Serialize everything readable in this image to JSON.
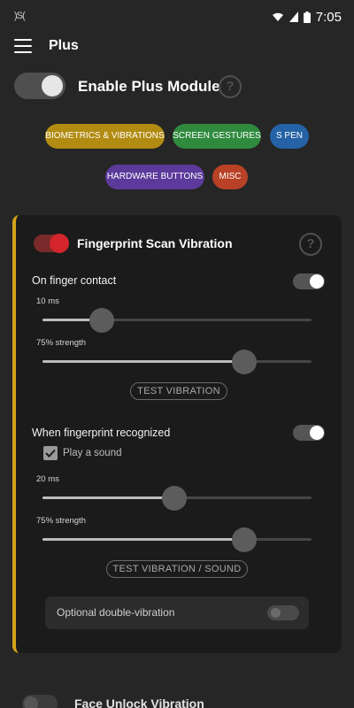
{
  "status_bar": {
    "left_glyph": ")S(",
    "time": "7:05"
  },
  "app_bar": {
    "title": "Plus"
  },
  "module": {
    "label": "Enable Plus Module",
    "enabled": true,
    "help": "?"
  },
  "chips": [
    {
      "label": "BIOMETRICS & VIBRATIONS",
      "color": "#b28b12"
    },
    {
      "label": "SCREEN GESTURES",
      "color": "#2f8a3e"
    },
    {
      "label": "S PEN",
      "color": "#2562a6"
    },
    {
      "label": "HARDWARE BUTTONS",
      "color": "#5c3a9b"
    },
    {
      "label": "MISC",
      "color": "#b84126"
    }
  ],
  "card": {
    "title": "Fingerprint Scan Vibration",
    "enabled": true,
    "accent": "#d4a21a",
    "help": "?",
    "contact": {
      "label": "On finger contact",
      "enabled": true,
      "duration_label": "10 ms",
      "duration_value": 0.22,
      "strength_label": "75% strength",
      "strength_value": 0.75,
      "test_button": "TEST VIBRATION"
    },
    "recognized": {
      "label": "When fingerprint recognized",
      "enabled": true,
      "sound_label": "Play a sound",
      "sound_checked": true,
      "duration_label": "20 ms",
      "duration_value": 0.49,
      "strength_label": "75% strength",
      "strength_value": 0.75,
      "test_button": "TEST VIBRATION / SOUND"
    },
    "double": {
      "label": "Optional double-vibration",
      "enabled": false
    }
  },
  "next_section": {
    "title": "Face Unlock Vibration",
    "enabled": false
  }
}
